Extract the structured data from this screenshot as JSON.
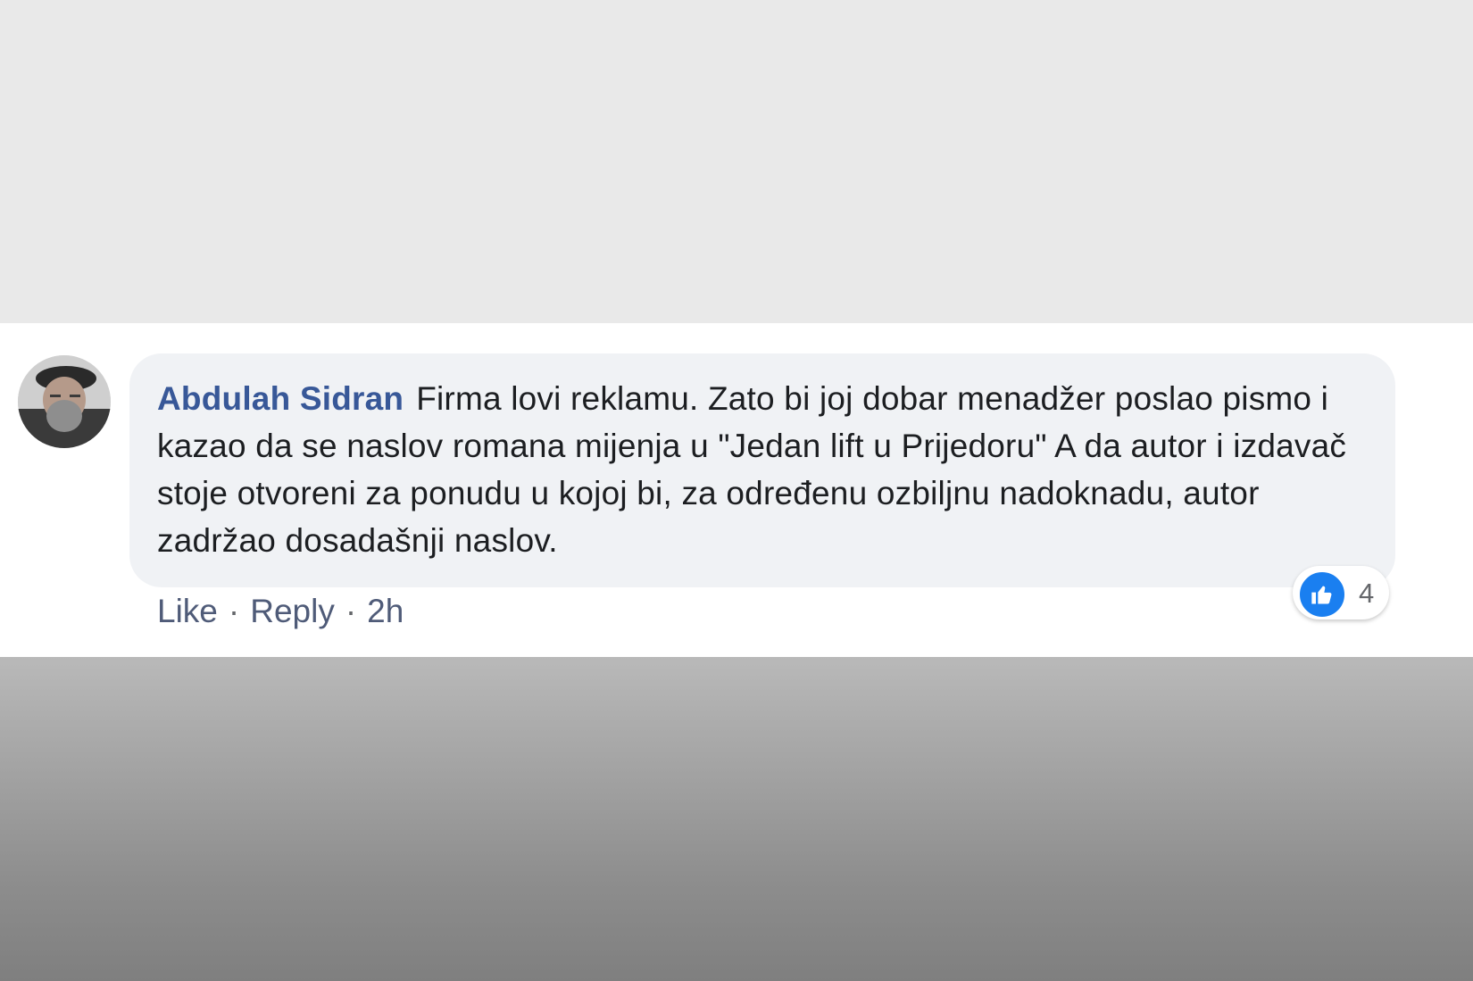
{
  "comment": {
    "author": "Abdulah Sidran",
    "text": "Firma lovi reklamu. Zato bi joj dobar menadžer poslao pismo i kazao da se naslov romana mijenja u \"Jedan lift u Prijedoru\" A da autor i izdavač stoje otvoreni za ponudu u kojoj bi, za određenu ozbiljnu nadoknadu, autor zadržao dosadašnji naslov.",
    "avatar_icon": "user-avatar-photo",
    "reaction": {
      "icon": "like-thumb-icon",
      "count": "4"
    },
    "actions": {
      "like_label": "Like",
      "separator": "·",
      "reply_label": "Reply",
      "timestamp": "2h"
    }
  },
  "colors": {
    "author_name": "#385898",
    "bubble_bg": "#f0f2f5",
    "like_blue": "#1a7ff0",
    "meta_text": "#65676b"
  }
}
